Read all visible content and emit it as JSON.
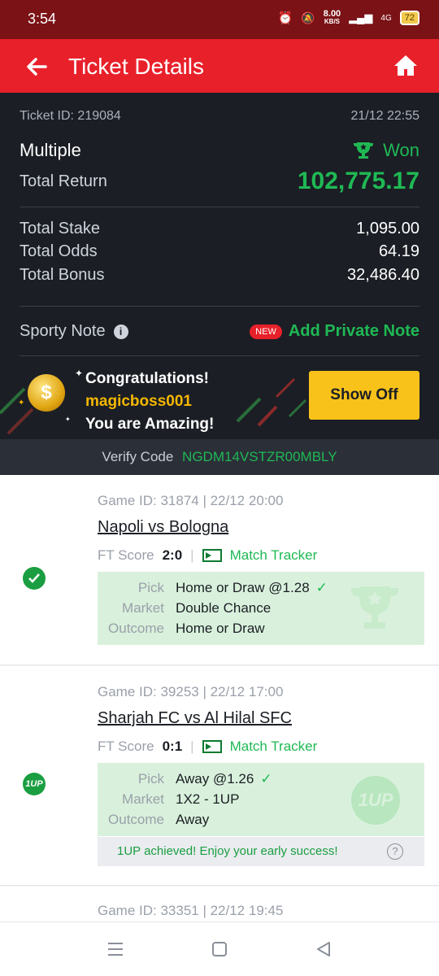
{
  "status_bar": {
    "time": "3:54",
    "net_speed": "8.00",
    "net_unit": "KB/S",
    "network": "4G",
    "battery": "72"
  },
  "app_bar": {
    "title": "Ticket Details"
  },
  "ticket": {
    "id_label": "Ticket ID: 219084",
    "datetime": "21/12 22:55",
    "type": "Multiple",
    "status": "Won",
    "total_return_label": "Total Return",
    "total_return": "102,775.17",
    "stake_label": "Total Stake",
    "stake": "1,095.00",
    "odds_label": "Total Odds",
    "odds": "64.19",
    "bonus_label": "Total Bonus",
    "bonus": "32,486.40",
    "note_label": "Sporty Note",
    "new_badge": "NEW",
    "add_note": "Add Private Note"
  },
  "congrats": {
    "line1": "Congratulations!",
    "username": "magicboss001",
    "line3": "You are Amazing!",
    "coin_symbol": "$",
    "show_off": "Show Off"
  },
  "verify": {
    "label": "Verify Code",
    "code": "NGDM14VSTZR00MBLY"
  },
  "games": [
    {
      "meta": "Game ID: 31874 | 22/12 20:00",
      "match": "Napoli vs Bologna",
      "ft_label": "FT Score",
      "score": "2:0",
      "tracker": "Match Tracker",
      "pick_label": "Pick",
      "pick": "Home or Draw @1.28",
      "market_label": "Market",
      "market": "Double Chance",
      "outcome_label": "Outcome",
      "outcome": "Home or Draw"
    },
    {
      "meta": "Game ID: 39253 | 22/12 17:00",
      "match": "Sharjah FC vs Al Hilal SFC",
      "ft_label": "FT Score",
      "score": "0:1",
      "tracker": "Match Tracker",
      "pick_label": "Pick",
      "pick": "Away @1.26",
      "market_label": "Market",
      "market": "1X2 - 1UP",
      "outcome_label": "Outcome",
      "outcome": "Away",
      "badge": "1UP",
      "success_msg": "1UP achieved! Enjoy your early success!"
    },
    {
      "meta": "Game ID: 33351 | 22/12 19:45"
    }
  ],
  "colors": {
    "brand_red": "#e8202a",
    "win_green": "#1fb954",
    "dark_bg": "#1b1e25",
    "gold": "#f8c21a"
  }
}
